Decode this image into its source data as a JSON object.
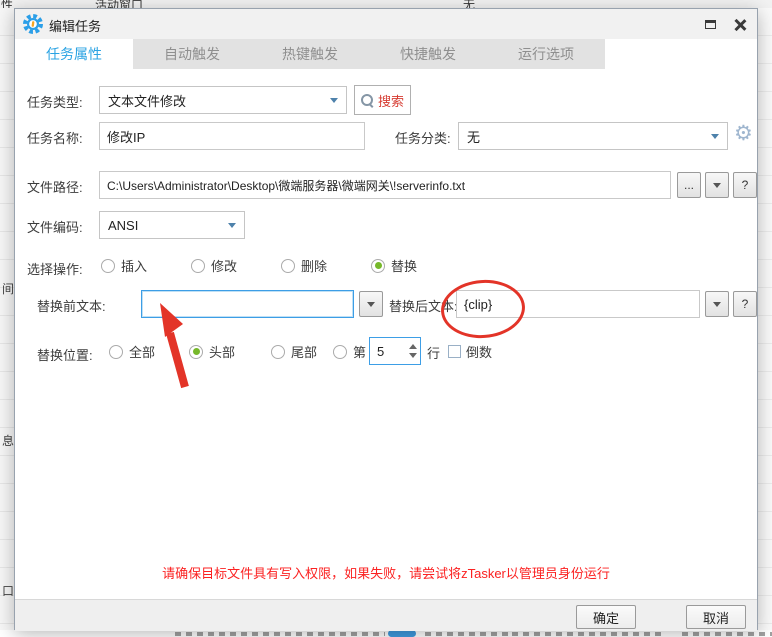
{
  "colors": {
    "accent_blue": "#2ba3e3",
    "radio_green": "#76b82a",
    "warning_red": "#fb2222",
    "annotation_red": "#e33428",
    "search_red": "#d63c32"
  },
  "icons": {
    "app_icon": "blue-gear-logo",
    "maximize_icon": "window-outline",
    "close_icon": "x-cross",
    "search_icon": "magnifier",
    "settings_gear": "⚙",
    "dropdown_arrow": "chevron-down",
    "spinner_arrows": "up-down-triangles"
  },
  "desktop": {
    "top_row": {
      "col1": "性",
      "col2": "活动窗口",
      "col3": "无"
    },
    "left_fragments": {
      "f1": "间",
      "f2": "息",
      "f3": "口"
    }
  },
  "dialog": {
    "title": "编辑任务",
    "tabs": [
      {
        "label": "任务属性",
        "active": true
      },
      {
        "label": "自动触发",
        "active": false
      },
      {
        "label": "热键触发",
        "active": false
      },
      {
        "label": "快捷触发",
        "active": false
      },
      {
        "label": "运行选项",
        "active": false
      }
    ],
    "form": {
      "task_type": {
        "label": "任务类型:",
        "value": "文本文件修改"
      },
      "search_button": {
        "label": "搜索"
      },
      "task_name": {
        "label": "任务名称:",
        "value": "修改IP"
      },
      "task_category": {
        "label": "任务分类:",
        "value": "无"
      },
      "file_path": {
        "label": "文件路径:",
        "value": "C:\\Users\\Administrator\\Desktop\\微端服务器\\微端网关\\!serverinfo.txt",
        "browse_label": "...",
        "help_label": "?"
      },
      "file_encoding": {
        "label": "文件编码:",
        "value": "ANSI"
      },
      "operation": {
        "label": "选择操作:",
        "options": [
          {
            "label": "插入",
            "selected": false
          },
          {
            "label": "修改",
            "selected": false
          },
          {
            "label": "删除",
            "selected": false
          },
          {
            "label": "替换",
            "selected": true
          }
        ]
      },
      "replace_before": {
        "label": "替换前文本:",
        "value": ""
      },
      "replace_after": {
        "label": "替换后文本:",
        "value": "{clip}",
        "help_label": "?"
      },
      "replace_position": {
        "label": "替换位置:",
        "options": [
          {
            "label": "全部",
            "selected": false
          },
          {
            "label": "头部",
            "selected": true
          },
          {
            "label": "尾部",
            "selected": false
          },
          {
            "label": "第",
            "selected": false
          }
        ],
        "line_value": "5",
        "line_unit": "行",
        "reverse": {
          "label": "倒数",
          "checked": false
        }
      }
    },
    "warning": "请确保目标文件具有写入权限，如果失败，请尝试将zTasker以管理员身份运行",
    "buttons": {
      "ok": "确定",
      "cancel": "取消"
    }
  }
}
